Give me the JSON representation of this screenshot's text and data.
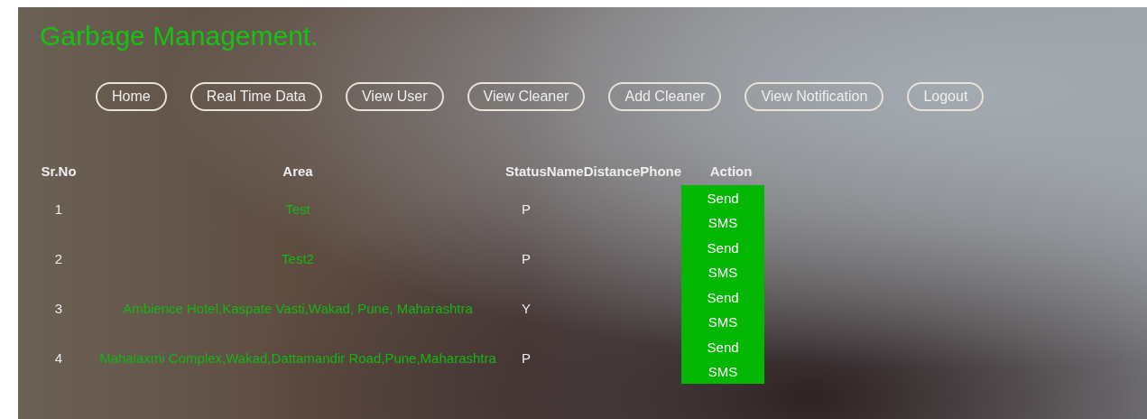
{
  "brand": "Garbage Management.",
  "nav": [
    "Home",
    "Real Time Data",
    "View User",
    "View Cleaner",
    "Add Cleaner",
    "View Notification",
    "Logout"
  ],
  "table": {
    "columns": [
      "Sr.No",
      "Area",
      "Status",
      "Name",
      "Distance",
      "Phone",
      "Action"
    ],
    "rows": [
      {
        "sr_no": "1",
        "area": "Test",
        "status": "P",
        "action": "Send SMS"
      },
      {
        "sr_no": "2",
        "area": "Test2",
        "status": "P",
        "action": "Send SMS"
      },
      {
        "sr_no": "3",
        "area": "Ambience Hotel,Kaspate Vasti,Wakad, Pune, Maharashtra",
        "status": "Y",
        "action": "Send SMS"
      },
      {
        "sr_no": "4",
        "area": "Mahalaxmi Complex,Wakad,Dattamandir Road,Pune,Maharashtra",
        "status": "P",
        "action": "Send SMS"
      }
    ]
  }
}
